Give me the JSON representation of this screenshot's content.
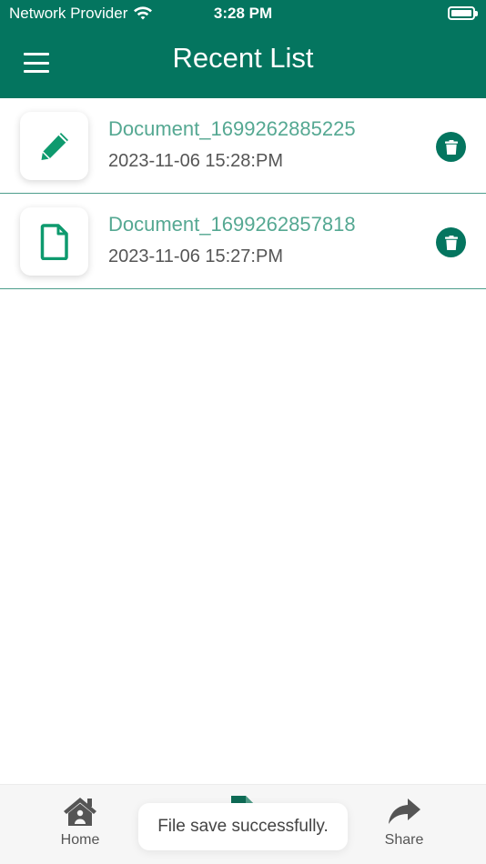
{
  "status_bar": {
    "carrier": "Network Provider",
    "time": "3:28 PM",
    "wifi_icon": "wifi-icon",
    "battery_icon": "battery-icon"
  },
  "header": {
    "title": "Recent List",
    "menu_icon": "hamburger-menu-icon",
    "background_color": "#04755f"
  },
  "documents": [
    {
      "name": "Document_1699262885225",
      "date": "2023-11-06 15:28:PM",
      "icon": "pen-icon"
    },
    {
      "name": "Document_1699262857818",
      "date": "2023-11-06 15:27:PM",
      "icon": "file-icon"
    }
  ],
  "delete_icon": "trash-icon",
  "tab_bar": {
    "home_label": "Home",
    "share_label": "Share",
    "home_icon": "home-icon",
    "middle_icon": "file-edit-icon",
    "share_icon": "share-arrow-icon"
  },
  "toast": {
    "message": "File save successfully."
  },
  "colors": {
    "accent": "#04755f",
    "document_name": "#55a892",
    "divider": "#4d9e8c"
  }
}
